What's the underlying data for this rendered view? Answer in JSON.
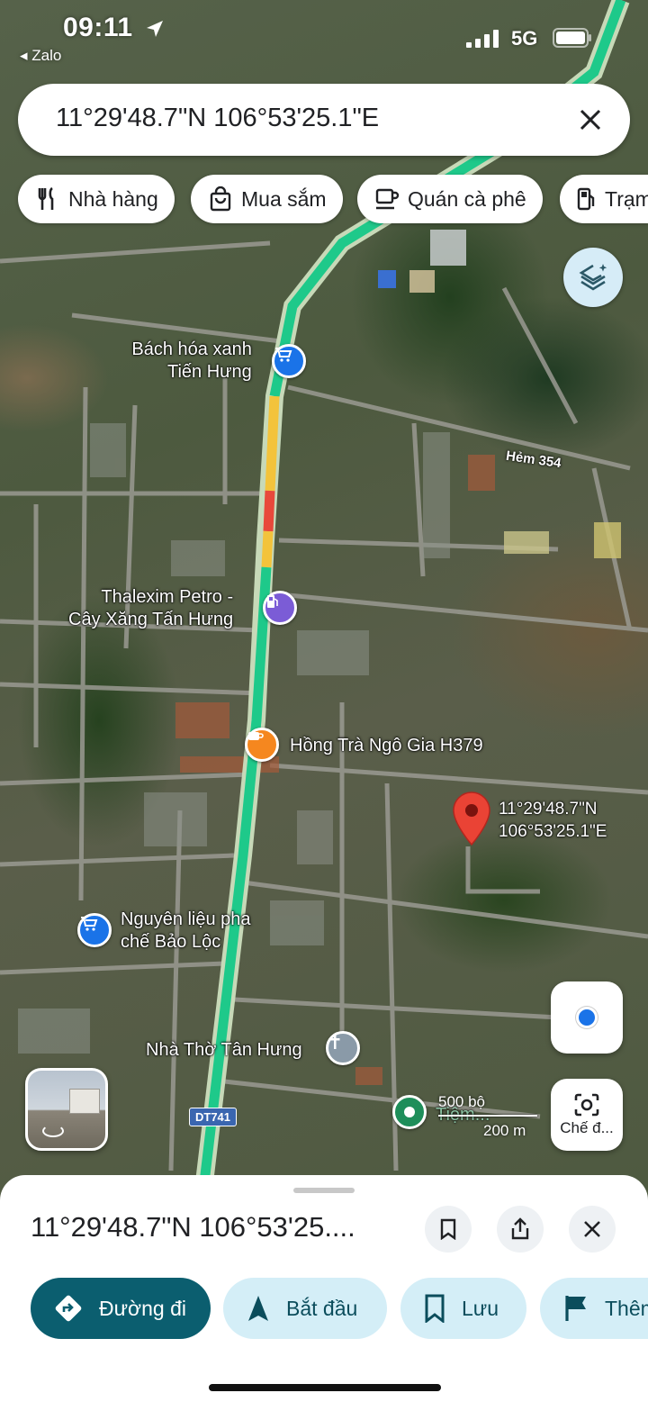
{
  "status_bar": {
    "time": "09:11",
    "back_app": "◂ Zalo",
    "network": "5G"
  },
  "search": {
    "query": "11°29'48.7\"N 106°53'25.1\"E",
    "clear_icon": "close-icon"
  },
  "chips": [
    {
      "label": "Nhà hàng",
      "icon": "restaurant-icon"
    },
    {
      "label": "Mua sắm",
      "icon": "shopping-bag-icon"
    },
    {
      "label": "Quán cà phê",
      "icon": "coffee-cup-icon"
    },
    {
      "label": "Trạm",
      "icon": "gas-station-icon"
    }
  ],
  "map": {
    "pois": [
      {
        "label_line1": "Bách hóa xanh",
        "label_line2": "Tiến Hưng",
        "icon": "shopping-cart-icon"
      },
      {
        "label_line1": "Thalexim Petro -",
        "label_line2": "Cây Xăng Tấn Hưng",
        "icon": "gas-station-icon"
      },
      {
        "label_line1": "Hồng Trà Ngô Gia H379",
        "icon": "coffee-cup-icon"
      },
      {
        "label_line1": "Nguyên liệu pha",
        "label_line2": "chế Bảo Lộc",
        "icon": "shopping-cart-icon"
      },
      {
        "label_line1": "Nhà Thờ Tân Hưng",
        "icon": "church-cross-icon"
      },
      {
        "label_line1": "Tiệm...",
        "icon": "map-pin-icon"
      }
    ],
    "road_labels": [
      "Hẻm 354"
    ],
    "route_badge": "DT741",
    "dropped_pin": {
      "line1": "11°29'48.7\"N",
      "line2": "106°53'25.1\"E",
      "color": "#ea4335"
    },
    "scale": {
      "feet": "500 bộ",
      "meters": "200 m"
    },
    "lens_label": "Chế đ...",
    "accent_route_color": "#1ec98a"
  },
  "sheet": {
    "title": "11°29'48.7\"N 106°53'25....",
    "actions": [
      {
        "label": "Đường đi",
        "icon": "directions-icon"
      },
      {
        "label": "Bắt đầu",
        "icon": "navigation-arrow-icon"
      },
      {
        "label": "Lưu",
        "icon": "bookmark-icon"
      },
      {
        "label": "Thêm",
        "icon": "flag-icon"
      }
    ]
  }
}
